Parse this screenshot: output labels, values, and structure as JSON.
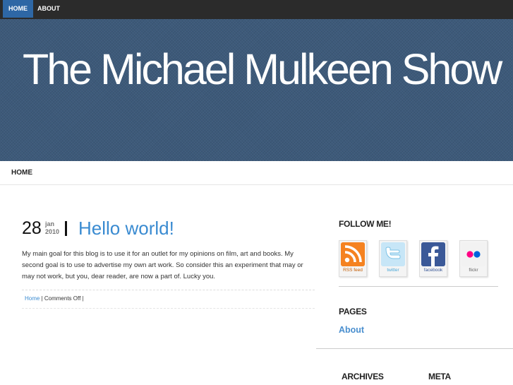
{
  "topnav": {
    "items": [
      {
        "label": "HOME"
      },
      {
        "label": "ABOUT"
      }
    ]
  },
  "header": {
    "title": "The Michael Mulkeen Show"
  },
  "subnav": {
    "home": "HOME"
  },
  "post": {
    "day": "28",
    "month": "jan",
    "year": "2010",
    "title": "Hello world!",
    "body": "My main goal for this blog is to use it for an outlet for my opinions on film, art and books. My second goal is to use to advertise my own art work. So consider this an experiment that may or may not work, but you, dear reader, are now a part of. Lucky you.",
    "meta": {
      "category": "Home",
      "sep1": " | ",
      "comments": "Comments Off",
      "sep2": " |"
    }
  },
  "sidebar": {
    "follow": {
      "heading": "FOLLOW ME!",
      "links": [
        {
          "icon": "rss-icon",
          "caption": "RSS feed"
        },
        {
          "icon": "twitter-icon",
          "caption": "twitter"
        },
        {
          "icon": "facebook-icon",
          "caption": "facebook"
        },
        {
          "icon": "flickr-icon",
          "caption": "flickr"
        }
      ]
    },
    "pages": {
      "heading": "PAGES",
      "items": [
        {
          "label": "About"
        }
      ]
    },
    "archives": {
      "heading": "ARCHIVES"
    },
    "meta": {
      "heading": "META"
    }
  },
  "colors": {
    "accent": "#2e67a5",
    "link": "#3a8bd1",
    "header_bg": "#3d5a7a",
    "topbar_bg": "#2b2b2b"
  }
}
